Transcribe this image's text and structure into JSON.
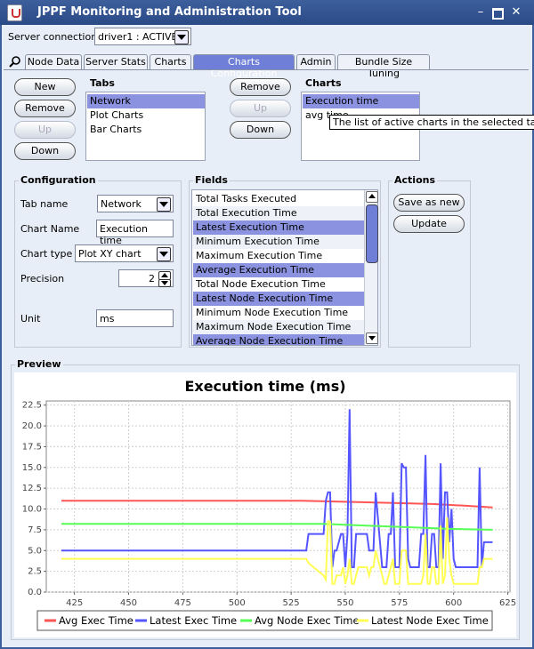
{
  "window": {
    "title": "JPPF Monitoring and Administration Tool"
  },
  "server": {
    "label": "Server connection",
    "value": "driver1 : ACTIVE"
  },
  "tabs": [
    {
      "label": "Node Data"
    },
    {
      "label": "Server Stats"
    },
    {
      "label": "Charts"
    },
    {
      "label": "Charts Configuration",
      "selected": true
    },
    {
      "label": "Admin"
    },
    {
      "label": "Bundle Size Tuning"
    }
  ],
  "tabs_panel": {
    "title": "Tabs",
    "buttons": {
      "new": "New",
      "remove": "Remove",
      "up": "Up",
      "down": "Down"
    },
    "items": [
      "Network",
      "Plot Charts",
      "Bar Charts"
    ]
  },
  "charts_panel": {
    "title": "Charts",
    "buttons": {
      "remove": "Remove",
      "up": "Up",
      "down": "Down"
    },
    "items": [
      "Execution time",
      "avg time"
    ],
    "tooltip": "The list of active charts in the selected tab"
  },
  "configuration": {
    "title": "Configuration",
    "tab_name_label": "Tab name",
    "tab_name_value": "Network",
    "chart_name_label": "Chart Name",
    "chart_name_value": "Execution time",
    "chart_type_label": "Chart type",
    "chart_type_value": "Plot XY chart",
    "precision_label": "Precision",
    "precision_value": "2",
    "unit_label": "Unit",
    "unit_value": "ms"
  },
  "fields": {
    "title": "Fields",
    "items": [
      {
        "label": "Total Tasks Executed",
        "selected": false
      },
      {
        "label": "Total Execution Time",
        "selected": false
      },
      {
        "label": "Latest Execution Time",
        "selected": true
      },
      {
        "label": "Minimum Execution Time",
        "selected": false
      },
      {
        "label": "Maximum Execution Time",
        "selected": false
      },
      {
        "label": "Average Execution Time",
        "selected": true
      },
      {
        "label": "Total Node Execution Time",
        "selected": false
      },
      {
        "label": "Latest Node Execution Time",
        "selected": true
      },
      {
        "label": "Minimum Node Execution Time",
        "selected": false
      },
      {
        "label": "Maximum Node Execution Time",
        "selected": false
      },
      {
        "label": "Average Node Execution Time",
        "selected": true
      }
    ]
  },
  "actions": {
    "title": "Actions",
    "save_as_new": "Save as new",
    "update": "Update"
  },
  "preview": {
    "title": "Preview"
  },
  "colors": {
    "accent": "#6f7fd8",
    "selection": "#8b93e0",
    "title_bar": "#3d5f9c"
  },
  "chart_data": {
    "type": "line",
    "title": "Execution time (ms)",
    "xlabel": "",
    "ylabel": "",
    "xlim": [
      412,
      626
    ],
    "ylim": [
      0,
      23
    ],
    "xticks": [
      425,
      450,
      475,
      500,
      525,
      550,
      575,
      600,
      625
    ],
    "yticks": [
      0.0,
      2.5,
      5.0,
      7.5,
      10.0,
      12.5,
      15.0,
      17.5,
      20.0,
      22.5
    ],
    "grid": true,
    "legend_position": "bottom",
    "series": [
      {
        "name": "Avg Exec Time",
        "color": "#ff5555",
        "x": [
          419,
          530,
          560,
          590,
          605,
          618
        ],
        "y": [
          11.0,
          11.0,
          10.8,
          10.6,
          10.4,
          10.2
        ]
      },
      {
        "name": "Latest Exec Time",
        "color": "#5555ff",
        "x": [
          419,
          532,
          533,
          540,
          541,
          542,
          543,
          544,
          545,
          546,
          548,
          549,
          550,
          551,
          552,
          553,
          554,
          555,
          556,
          560,
          561,
          562,
          563,
          564,
          567,
          568,
          569,
          570,
          571,
          572,
          573,
          575,
          576,
          577,
          578,
          579,
          580,
          581,
          584,
          585,
          586,
          587,
          588,
          589,
          590,
          591,
          592,
          593,
          594,
          595,
          596,
          597,
          598,
          599,
          600,
          601,
          610,
          611,
          612,
          613,
          614,
          615,
          616,
          618
        ],
        "y": [
          5,
          5,
          7,
          7,
          11,
          12,
          12,
          3,
          5,
          5,
          7,
          7,
          3,
          7,
          22,
          3,
          3,
          7,
          7,
          7,
          5,
          5,
          5,
          12,
          3,
          3,
          3,
          7,
          7,
          12,
          3,
          3,
          15.5,
          15,
          15,
          4,
          3,
          3,
          3,
          7,
          7,
          16.5,
          3,
          3,
          7,
          7,
          3,
          3,
          15.5,
          4,
          12,
          12,
          6,
          10,
          4,
          3,
          3,
          3,
          15,
          3,
          6,
          6,
          6,
          6
        ]
      },
      {
        "name": "Avg Node Exec Time",
        "color": "#55ff55",
        "x": [
          419,
          540,
          560,
          580,
          600,
          618
        ],
        "y": [
          8.2,
          8.2,
          8.0,
          7.8,
          7.6,
          7.5
        ]
      },
      {
        "name": "Latest Node Exec Time",
        "color": "#ffff55",
        "x": [
          419,
          532,
          533,
          540,
          541,
          542,
          543,
          544,
          545,
          546,
          548,
          549,
          550,
          551,
          552,
          553,
          554,
          555,
          556,
          560,
          561,
          562,
          563,
          564,
          567,
          568,
          569,
          570,
          571,
          572,
          573,
          575,
          576,
          577,
          578,
          579,
          580,
          581,
          584,
          585,
          586,
          587,
          588,
          589,
          590,
          591,
          592,
          593,
          594,
          595,
          596,
          597,
          598,
          599,
          600,
          601,
          610,
          611,
          612,
          613,
          614,
          615,
          616,
          618
        ],
        "y": [
          4,
          4,
          3.5,
          2,
          1.5,
          8.5,
          8.5,
          1,
          1,
          2,
          2,
          3,
          1,
          2,
          4,
          1,
          1,
          2,
          3,
          3,
          2,
          3,
          3,
          5,
          2,
          1,
          1,
          2,
          3,
          4,
          1,
          1,
          5,
          5,
          5,
          1,
          1,
          1,
          1,
          1,
          2,
          7,
          1,
          1,
          3,
          3,
          1,
          1,
          8,
          1,
          2,
          9,
          4,
          2,
          1,
          1,
          1,
          1,
          3,
          3,
          4,
          4,
          4,
          4
        ]
      }
    ]
  }
}
